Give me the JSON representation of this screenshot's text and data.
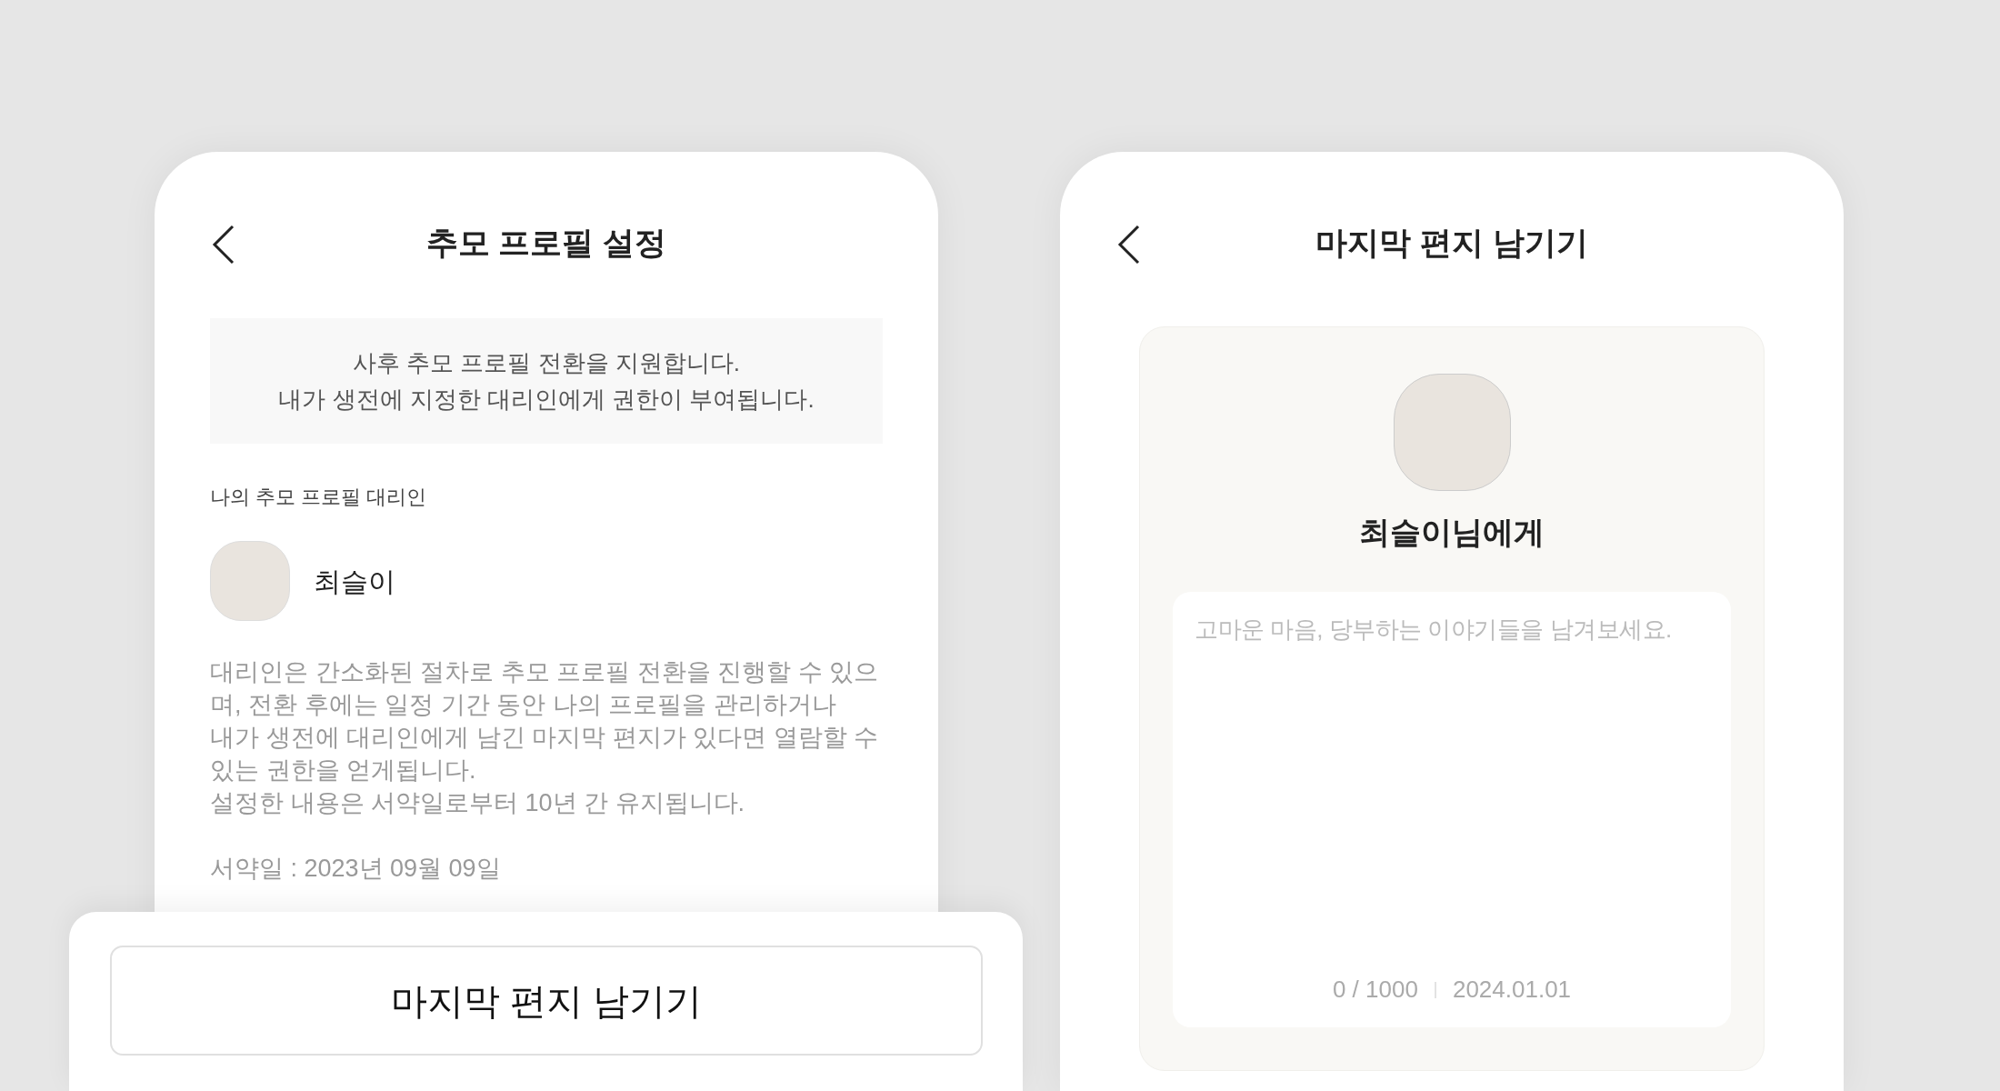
{
  "screens": [
    {
      "title": "추모 프로필 설정",
      "notice": [
        "사후 추모 프로필 전환을 지원합니다.",
        "내가 생전에 지정한 대리인에게 권한이 부여됩니다."
      ],
      "section_label": "나의 추모 프로필 대리인",
      "proxy_name": "최슬이",
      "description": "대리인은 간소화된 절차로 추모 프로필 전환을 진행할 수 있으며, 전환 후에는 일정 기간 동안 나의 프로필을 관리하거나\n내가 생전에 대리인에게 남긴 마지막 편지가 있다면 열람할 수 있는 권한을 얻게됩니다.\n설정한 내용은 서약일로부터 10년 간 유지됩니다.",
      "pledge_date": "서약일 : 2023년 09월 09일",
      "bottom_button": "마지막 편지 남기기"
    },
    {
      "title": "마지막 편지 남기기",
      "recipient": "최슬이님에게",
      "letter": {
        "placeholder": "고마운 마음, 당부하는 이야기들을 남겨보세요.",
        "counter": "0 / 1000",
        "date": "2024.01.01"
      }
    }
  ]
}
